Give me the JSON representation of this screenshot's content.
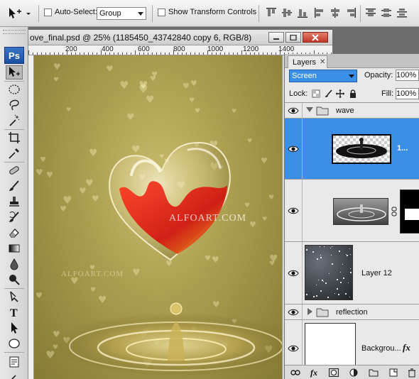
{
  "options_bar": {
    "auto_select_label": "Auto-Select:",
    "auto_select_value": "Group",
    "auto_select_checked": false,
    "show_transform_label": "Show Transform Controls",
    "show_transform_checked": false
  },
  "toolbox": {
    "logo_text": "Ps",
    "tools": [
      "move-tool",
      "elliptical-marquee-tool",
      "lasso-tool",
      "magic-wand-tool",
      "crop-tool",
      "eyedropper-tool",
      "healing-brush-tool",
      "brush-tool",
      "clone-stamp-tool",
      "history-brush-tool",
      "eraser-tool",
      "gradient-tool",
      "blur-tool",
      "dodge-tool",
      "pen-tool",
      "type-tool",
      "path-selection-tool",
      "ellipse-tool",
      "notes-tool"
    ]
  },
  "document": {
    "title": "ove_final.psd @ 25% (1185450_43742840 copy 6, RGB/8)",
    "ruler_labels": [
      "200",
      "400",
      "600",
      "800",
      "1000",
      "1200",
      "1400"
    ],
    "watermark_main": "ALFOART.COM",
    "watermark_secondary": "ALFOART.COM"
  },
  "layers_panel": {
    "tab_label": "Layers",
    "blend_mode": "Screen",
    "opacity_label": "Opacity:",
    "opacity_value": "100%",
    "lock_label": "Lock:",
    "fill_label": "Fill:",
    "fill_value": "100%",
    "layers": [
      {
        "name": "wave",
        "type": "group",
        "expanded": true
      },
      {
        "name": "1...",
        "type": "layer",
        "selected": true
      },
      {
        "name": "",
        "type": "layer-with-mask"
      },
      {
        "name": "Layer 12",
        "type": "layer"
      },
      {
        "name": "reflection",
        "type": "group",
        "expanded": false
      },
      {
        "name": "Backgrou...",
        "type": "background",
        "has_fx": true,
        "fx_label": "fx"
      }
    ],
    "footer_icons": [
      "link-icon",
      "fx-icon",
      "mask-icon",
      "adjustment-icon",
      "group-folder-icon",
      "new-layer-icon",
      "trash-icon"
    ],
    "footer_fx_label": "fx"
  },
  "colors": {
    "selection": "#3b8fe6",
    "canvas_gold": "#b0a255",
    "heart_red": "#d8201a"
  }
}
